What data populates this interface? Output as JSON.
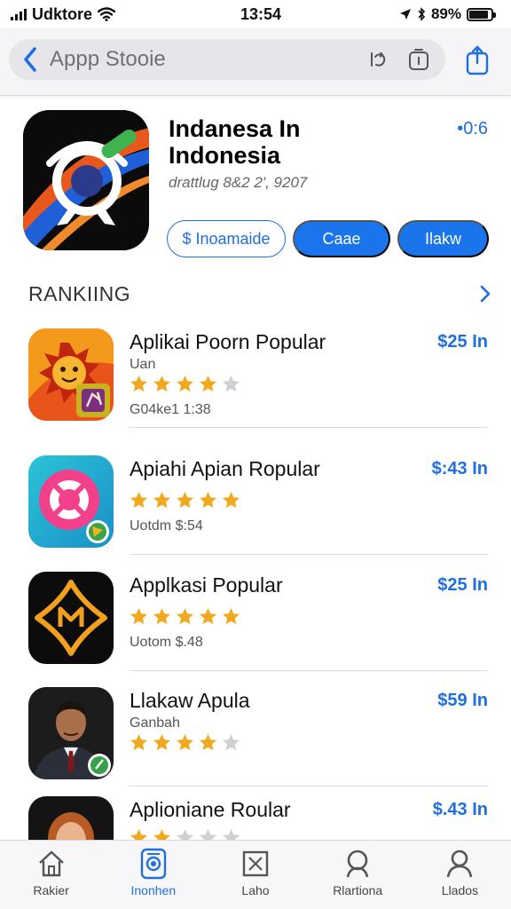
{
  "status_bar": {
    "carrier": "Udktore",
    "time": "13:54",
    "battery": "89%",
    "battery_level": 0.89
  },
  "header": {
    "title": "Appp Stooie",
    "icons": [
      "back-chevron-icon",
      "refresh-icon",
      "copy-icon",
      "share-icon"
    ]
  },
  "app": {
    "title_line1": "Indanesa In",
    "title_line2": "Indonesia",
    "meta": "drattlug 8&2 2', 9207",
    "size": "•0:6",
    "buttons": {
      "outline": "$ Inoamaide",
      "primary1": "Caae",
      "primary2": "Ilakw"
    }
  },
  "ranking": {
    "title": "RANKIING",
    "items": [
      {
        "name": "Aplikai Poorn Popular",
        "sub": "Uan",
        "rating": 4,
        "meta": "G04ke1 1:38",
        "price": "$25 In"
      },
      {
        "name": "Apiahi Apian Ropular",
        "sub": "",
        "rating": 5,
        "meta": "Uotdm $:54",
        "price": "$:43 In"
      },
      {
        "name": "Applkasi Popular",
        "sub": "",
        "rating": 5,
        "meta": "Uotom $.48",
        "price": "$25 In"
      },
      {
        "name": "Llakaw Apula",
        "sub": "Ganbah",
        "rating": 4,
        "meta": "",
        "price": "$59 In"
      },
      {
        "name": "Aplioniane Roular",
        "sub": "",
        "rating": 2,
        "meta": "",
        "price": "$.43 In"
      }
    ]
  },
  "tabs": [
    {
      "label": "Rakier",
      "icon": "home-icon",
      "active": false
    },
    {
      "label": "Inonhen",
      "icon": "camera-icon",
      "active": true
    },
    {
      "label": "Laho",
      "icon": "box-icon",
      "active": false
    },
    {
      "label": "Rlartiona",
      "icon": "search-icon",
      "active": false
    },
    {
      "label": "Llados",
      "icon": "person-icon",
      "active": false
    }
  ],
  "colors": {
    "accent": "#1f6fe0",
    "button_fill": "#1a74ec",
    "star": "#f2a81d",
    "star_empty": "#d0d0d4"
  }
}
